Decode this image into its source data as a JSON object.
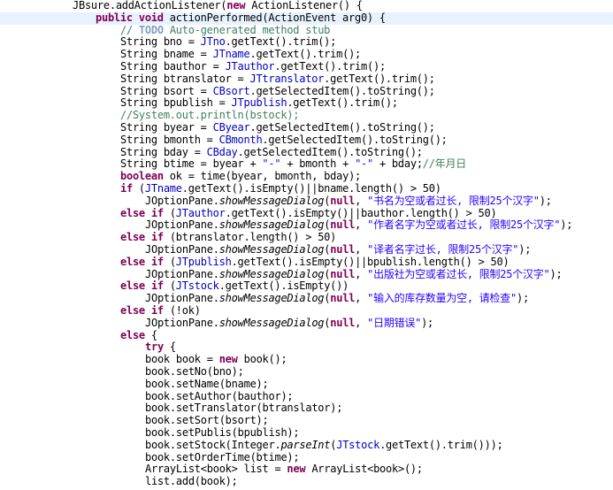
{
  "editor": {
    "language": "java",
    "lines": [
      {
        "indent": 0,
        "tokens": [
          {
            "t": "JBsure.",
            "c": ""
          },
          {
            "t": "addActionListener(",
            "c": ""
          },
          {
            "t": "new",
            "c": "kw"
          },
          {
            "t": " ActionListener() {",
            "c": ""
          }
        ]
      },
      {
        "indent": 1,
        "highlight": true,
        "tokens": [
          {
            "t": "public",
            "c": "kw"
          },
          {
            "t": " ",
            "c": ""
          },
          {
            "t": "void",
            "c": "kw"
          },
          {
            "t": " actionPerformed(ActionEvent arg0) {",
            "c": ""
          }
        ]
      },
      {
        "indent": 2,
        "tokens": [
          {
            "t": "// ",
            "c": "cmt"
          },
          {
            "t": "TODO",
            "c": "todo"
          },
          {
            "t": " Auto-generated method stub",
            "c": "cmt"
          }
        ]
      },
      {
        "indent": 2,
        "tokens": [
          {
            "t": "String bno = ",
            "c": ""
          },
          {
            "t": "JTno",
            "c": "fld"
          },
          {
            "t": ".getText().trim();",
            "c": ""
          }
        ]
      },
      {
        "indent": 2,
        "tokens": [
          {
            "t": "String bname = ",
            "c": ""
          },
          {
            "t": "JTname",
            "c": "fld"
          },
          {
            "t": ".getText().trim();",
            "c": ""
          }
        ]
      },
      {
        "indent": 2,
        "tokens": [
          {
            "t": "String bauthor = ",
            "c": ""
          },
          {
            "t": "JTauthor",
            "c": "fld"
          },
          {
            "t": ".getText().trim();",
            "c": ""
          }
        ]
      },
      {
        "indent": 2,
        "tokens": [
          {
            "t": "String btranslator = ",
            "c": ""
          },
          {
            "t": "JTtranslator",
            "c": "fld"
          },
          {
            "t": ".getText().trim();",
            "c": ""
          }
        ]
      },
      {
        "indent": 2,
        "tokens": [
          {
            "t": "String bsort = ",
            "c": ""
          },
          {
            "t": "CBsort",
            "c": "fld"
          },
          {
            "t": ".getSelectedItem().toString();",
            "c": ""
          }
        ]
      },
      {
        "indent": 2,
        "tokens": [
          {
            "t": "String bpublish = ",
            "c": ""
          },
          {
            "t": "JTpublish",
            "c": "fld"
          },
          {
            "t": ".getText().trim();",
            "c": ""
          }
        ]
      },
      {
        "indent": 2,
        "tokens": [
          {
            "t": "//System.out.println(bstock);",
            "c": "cmt"
          }
        ]
      },
      {
        "indent": 2,
        "tokens": [
          {
            "t": "String byear = ",
            "c": ""
          },
          {
            "t": "CByear",
            "c": "fld"
          },
          {
            "t": ".getSelectedItem().toString();",
            "c": ""
          }
        ]
      },
      {
        "indent": 2,
        "tokens": [
          {
            "t": "String bmonth = ",
            "c": ""
          },
          {
            "t": "CBmonth",
            "c": "fld"
          },
          {
            "t": ".getSelectedItem().toString();",
            "c": ""
          }
        ]
      },
      {
        "indent": 2,
        "tokens": [
          {
            "t": "String bday = ",
            "c": ""
          },
          {
            "t": "CBday",
            "c": "fld"
          },
          {
            "t": ".getSelectedItem().toString();",
            "c": ""
          }
        ]
      },
      {
        "indent": 2,
        "tokens": [
          {
            "t": "String btime = byear + ",
            "c": ""
          },
          {
            "t": "\"-\"",
            "c": "str"
          },
          {
            "t": " + bmonth + ",
            "c": ""
          },
          {
            "t": "\"-\"",
            "c": "str"
          },
          {
            "t": " + bday;",
            "c": ""
          },
          {
            "t": "//年月日",
            "c": "cmt"
          }
        ]
      },
      {
        "indent": 2,
        "tokens": [
          {
            "t": "boolean",
            "c": "kw"
          },
          {
            "t": " ok = time(byear, bmonth, bday);",
            "c": ""
          }
        ]
      },
      {
        "indent": 2,
        "tokens": [
          {
            "t": "if",
            "c": "kw"
          },
          {
            "t": " (",
            "c": ""
          },
          {
            "t": "JTname",
            "c": "fld"
          },
          {
            "t": ".getText().isEmpty()||bname.length() > 50)",
            "c": ""
          }
        ]
      },
      {
        "indent": 3,
        "tokens": [
          {
            "t": "JOptionPane.",
            "c": ""
          },
          {
            "t": "showMessageDialog",
            "c": "ital"
          },
          {
            "t": "(",
            "c": ""
          },
          {
            "t": "null",
            "c": "kw"
          },
          {
            "t": ", ",
            "c": ""
          },
          {
            "t": "\"书名为空或者过长, 限制25个汉字\"",
            "c": "str"
          },
          {
            "t": ");",
            "c": ""
          }
        ]
      },
      {
        "indent": 2,
        "tokens": [
          {
            "t": "else",
            "c": "kw"
          },
          {
            "t": " ",
            "c": ""
          },
          {
            "t": "if",
            "c": "kw"
          },
          {
            "t": " (",
            "c": ""
          },
          {
            "t": "JTauthor",
            "c": "fld"
          },
          {
            "t": ".getText().isEmpty()||bauthor.length() > 50)",
            "c": ""
          }
        ]
      },
      {
        "indent": 3,
        "tokens": [
          {
            "t": "JOptionPane.",
            "c": ""
          },
          {
            "t": "showMessageDialog",
            "c": "ital"
          },
          {
            "t": "(",
            "c": ""
          },
          {
            "t": "null",
            "c": "kw"
          },
          {
            "t": ", ",
            "c": ""
          },
          {
            "t": "\"作者名字为空或者过长, 限制25个汉字\"",
            "c": "str"
          },
          {
            "t": ");",
            "c": ""
          }
        ]
      },
      {
        "indent": 2,
        "tokens": [
          {
            "t": "else",
            "c": "kw"
          },
          {
            "t": " ",
            "c": ""
          },
          {
            "t": "if",
            "c": "kw"
          },
          {
            "t": " (btranslator.length() > 50)",
            "c": ""
          }
        ]
      },
      {
        "indent": 3,
        "tokens": [
          {
            "t": "JOptionPane.",
            "c": ""
          },
          {
            "t": "showMessageDialog",
            "c": "ital"
          },
          {
            "t": "(",
            "c": ""
          },
          {
            "t": "null",
            "c": "kw"
          },
          {
            "t": ", ",
            "c": ""
          },
          {
            "t": "\"译者名字过长, 限制25个汉字\"",
            "c": "str"
          },
          {
            "t": ");",
            "c": ""
          }
        ]
      },
      {
        "indent": 2,
        "tokens": [
          {
            "t": "else",
            "c": "kw"
          },
          {
            "t": " ",
            "c": ""
          },
          {
            "t": "if",
            "c": "kw"
          },
          {
            "t": " (",
            "c": ""
          },
          {
            "t": "JTpublish",
            "c": "fld"
          },
          {
            "t": ".getText().isEmpty()||bpublish.length() > 50)",
            "c": ""
          }
        ]
      },
      {
        "indent": 3,
        "tokens": [
          {
            "t": "JOptionPane.",
            "c": ""
          },
          {
            "t": "showMessageDialog",
            "c": "ital"
          },
          {
            "t": "(",
            "c": ""
          },
          {
            "t": "null",
            "c": "kw"
          },
          {
            "t": ", ",
            "c": ""
          },
          {
            "t": "\"出版社为空或者过长, 限制25个汉字\"",
            "c": "str"
          },
          {
            "t": ");",
            "c": ""
          }
        ]
      },
      {
        "indent": 2,
        "tokens": [
          {
            "t": "else",
            "c": "kw"
          },
          {
            "t": " ",
            "c": ""
          },
          {
            "t": "if",
            "c": "kw"
          },
          {
            "t": " (",
            "c": ""
          },
          {
            "t": "JTstock",
            "c": "fld"
          },
          {
            "t": ".getText().isEmpty())",
            "c": ""
          }
        ]
      },
      {
        "indent": 3,
        "tokens": [
          {
            "t": "JOptionPane.",
            "c": ""
          },
          {
            "t": "showMessageDialog",
            "c": "ital"
          },
          {
            "t": "(",
            "c": ""
          },
          {
            "t": "null",
            "c": "kw"
          },
          {
            "t": ", ",
            "c": ""
          },
          {
            "t": "\"输入的库存数量为空, 请检查\"",
            "c": "str"
          },
          {
            "t": ");",
            "c": ""
          }
        ]
      },
      {
        "indent": 2,
        "tokens": [
          {
            "t": "else",
            "c": "kw"
          },
          {
            "t": " ",
            "c": ""
          },
          {
            "t": "if",
            "c": "kw"
          },
          {
            "t": " (!ok)",
            "c": ""
          }
        ]
      },
      {
        "indent": 3,
        "tokens": [
          {
            "t": "JOptionPane.",
            "c": ""
          },
          {
            "t": "showMessageDialog",
            "c": "ital"
          },
          {
            "t": "(",
            "c": ""
          },
          {
            "t": "null",
            "c": "kw"
          },
          {
            "t": ", ",
            "c": ""
          },
          {
            "t": "\"日期错误\"",
            "c": "str"
          },
          {
            "t": ");",
            "c": ""
          }
        ]
      },
      {
        "indent": 2,
        "tokens": [
          {
            "t": "else",
            "c": "kw"
          },
          {
            "t": " {",
            "c": ""
          }
        ]
      },
      {
        "indent": 3,
        "tokens": [
          {
            "t": "try",
            "c": "kw"
          },
          {
            "t": " {",
            "c": ""
          }
        ]
      },
      {
        "indent": 3,
        "tokens": [
          {
            "t": "book book = ",
            "c": ""
          },
          {
            "t": "new",
            "c": "kw"
          },
          {
            "t": " book();",
            "c": ""
          }
        ]
      },
      {
        "indent": 3,
        "tokens": [
          {
            "t": "book.setNo(bno);",
            "c": ""
          }
        ]
      },
      {
        "indent": 3,
        "tokens": [
          {
            "t": "book.setName(bname);",
            "c": ""
          }
        ]
      },
      {
        "indent": 3,
        "tokens": [
          {
            "t": "book.setAuthor(bauthor);",
            "c": ""
          }
        ]
      },
      {
        "indent": 3,
        "tokens": [
          {
            "t": "book.setTranslator(btranslator);",
            "c": ""
          }
        ]
      },
      {
        "indent": 3,
        "tokens": [
          {
            "t": "book.setSort(bsort);",
            "c": ""
          }
        ]
      },
      {
        "indent": 3,
        "tokens": [
          {
            "t": "book.setPublis(bpublish);",
            "c": ""
          }
        ]
      },
      {
        "indent": 3,
        "tokens": [
          {
            "t": "book.setStock(Integer.",
            "c": ""
          },
          {
            "t": "parseInt",
            "c": "ital"
          },
          {
            "t": "(",
            "c": ""
          },
          {
            "t": "JTstock",
            "c": "fld"
          },
          {
            "t": ".getText().trim()));",
            "c": ""
          }
        ]
      },
      {
        "indent": 3,
        "tokens": [
          {
            "t": "book.setOrderTime(btime);",
            "c": ""
          }
        ]
      },
      {
        "indent": 3,
        "tokens": [
          {
            "t": "ArrayList<book> list = ",
            "c": ""
          },
          {
            "t": "new",
            "c": "kw"
          },
          {
            "t": " ArrayList<book>();",
            "c": ""
          }
        ]
      },
      {
        "indent": 3,
        "tokens": [
          {
            "t": "list.add(book);",
            "c": ""
          }
        ]
      }
    ]
  },
  "colors": {
    "keyword": "#7f0055",
    "field": "#0000c0",
    "comment": "#3f7f5f",
    "string": "#2a00ff",
    "current_line": "#e8f2fe"
  }
}
